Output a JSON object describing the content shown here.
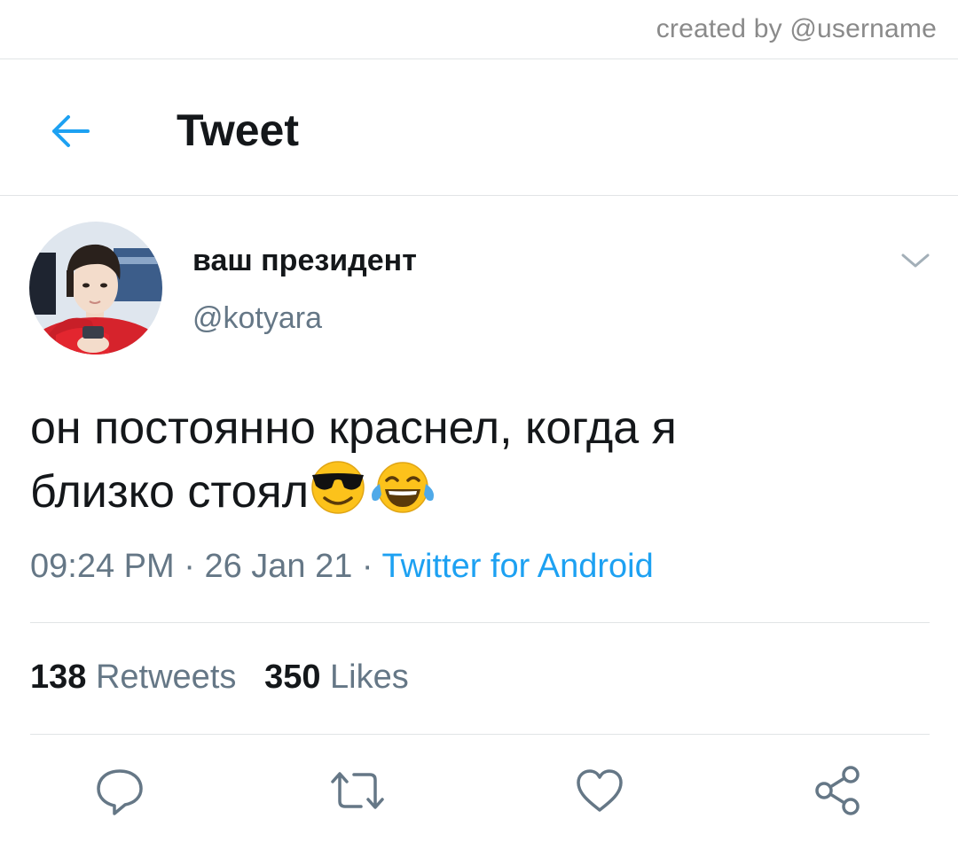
{
  "watermark": {
    "credit": "created by @username"
  },
  "header": {
    "title": "Tweet",
    "back_icon": "back-arrow-icon"
  },
  "tweet": {
    "display_name": "ваш президент",
    "handle": "@kotyara",
    "text_line1": "он постоянно краснел, когда я",
    "text_line2": "близко стоял",
    "emojis": [
      "sunglasses-emoji",
      "tears-of-joy-emoji"
    ],
    "time": "09:24 PM",
    "date": "26 Jan 21",
    "separator": "·",
    "source": "Twitter for Android",
    "retweets_count": "138",
    "retweets_label": "Retweets",
    "likes_count": "350",
    "likes_label": "Likes"
  },
  "actions": [
    "reply-icon",
    "retweet-icon",
    "like-icon",
    "share-icon"
  ],
  "colors": {
    "accent": "#1da1f2",
    "text_primary": "#14171a",
    "text_secondary": "#657786",
    "divider": "#e1e4e6"
  }
}
